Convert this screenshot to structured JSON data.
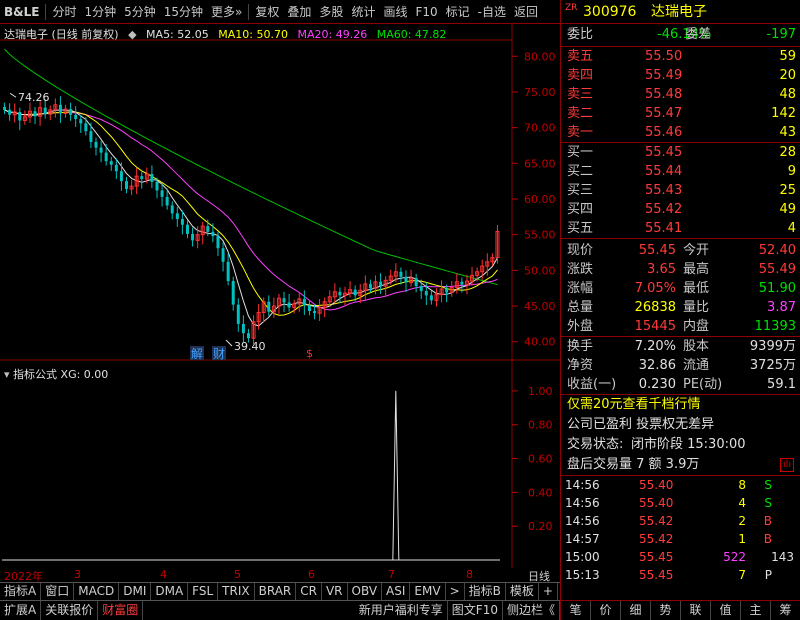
{
  "toolbar": {
    "logo": "B&LE",
    "items": [
      "分时",
      "1分钟",
      "5分钟",
      "15分钟",
      "更多»",
      "复权",
      "叠加",
      "多股",
      "统计",
      "画线",
      "F10",
      "标记",
      "-自选",
      "返回"
    ]
  },
  "main_info": {
    "name": "达瑞电子 (日线 前复权)",
    "ma5": "MA5: 52.05",
    "ma10": "MA10: 50.70",
    "ma20": "MA20: 49.26",
    "ma60": "MA60: 47.82"
  },
  "price_axis": [
    "80.00",
    "75.00",
    "70.00",
    "65.00",
    "60.00",
    "55.00",
    "50.00",
    "45.00",
    "40.00"
  ],
  "sub_axis": [
    "1.00",
    "0.80",
    "0.60",
    "0.40",
    "0.20"
  ],
  "annotations": {
    "high": "74.26",
    "low": "39.40",
    "tag_jie": "解",
    "tag_cai": "财",
    "tag_s": "$"
  },
  "sub_info": {
    "title": "指标公式 XG: 0.00"
  },
  "date_row": {
    "year": "2022年",
    "m3": "3",
    "m4": "4",
    "m5": "5",
    "m6": "6",
    "m7": "7",
    "m8": "8",
    "period": "日线"
  },
  "tabs1": [
    "指标A",
    "窗口",
    "MACD",
    "DMI",
    "DMA",
    "FSL",
    "TRIX",
    "BRAR",
    "CR",
    "VR",
    "OBV",
    "ASI",
    "EMV",
    ">",
    "指标B",
    "模板",
    "+",
    "-"
  ],
  "tabs2": [
    "扩展A",
    "关联报价",
    "财富圈",
    "新用户福利专享",
    "图文F10",
    "侧边栏《"
  ],
  "stock": {
    "zr": "ZR",
    "code": "300976",
    "name": "达瑞电子"
  },
  "wei": {
    "webi_label": "委比",
    "webi": "-46.14%",
    "weicha_label": "委差",
    "weicha": "-197"
  },
  "asks": [
    {
      "label": "卖五",
      "price": "55.50",
      "vol": "59"
    },
    {
      "label": "卖四",
      "price": "55.49",
      "vol": "20"
    },
    {
      "label": "卖三",
      "price": "55.48",
      "vol": "48"
    },
    {
      "label": "卖二",
      "price": "55.47",
      "vol": "142"
    },
    {
      "label": "卖一",
      "price": "55.46",
      "vol": "43"
    }
  ],
  "bids": [
    {
      "label": "买一",
      "price": "55.45",
      "vol": "28"
    },
    {
      "label": "买二",
      "price": "55.44",
      "vol": "9"
    },
    {
      "label": "买三",
      "price": "55.43",
      "vol": "25"
    },
    {
      "label": "买四",
      "price": "55.42",
      "vol": "49"
    },
    {
      "label": "买五",
      "price": "55.41",
      "vol": "4"
    }
  ],
  "quote": [
    {
      "l1": "现价",
      "v1": "55.45",
      "l2": "今开",
      "v2": "52.40"
    },
    {
      "l1": "涨跌",
      "v1": "3.65",
      "l2": "最高",
      "v2": "55.49"
    },
    {
      "l1": "涨幅",
      "v1": "7.05%",
      "l2": "最低",
      "v2": "51.90"
    },
    {
      "l1": "总量",
      "v1": "26838",
      "l2": "量比",
      "v2": "3.87"
    },
    {
      "l1": "外盘",
      "v1": "15445",
      "l2": "内盘",
      "v2": "11393"
    }
  ],
  "fund": [
    {
      "l1": "换手",
      "v1": "7.20%",
      "l2": "股本",
      "v2": "9399万"
    },
    {
      "l1": "净资",
      "v1": "32.86",
      "l2": "流通",
      "v2": "3725万"
    },
    {
      "l1": "收益(一)",
      "v1": "0.230",
      "l2": "PE(动)",
      "v2": "59.1"
    }
  ],
  "promo": "仅需20元查看千档行情",
  "notice": "公司已盈利 投票权无差异",
  "status_label": "交易状态:",
  "status_value": "闭市阶段 15:30:00",
  "after_hours": "盘后交易量 7 额 3.9万",
  "ticks": [
    {
      "t": "14:56",
      "p": "55.40",
      "v": "8",
      "d": "S"
    },
    {
      "t": "14:56",
      "p": "55.40",
      "v": "4",
      "d": "S"
    },
    {
      "t": "14:56",
      "p": "55.42",
      "v": "2",
      "d": "B"
    },
    {
      "t": "14:57",
      "p": "55.42",
      "v": "1",
      "d": "B"
    },
    {
      "t": "15:00",
      "p": "55.45",
      "v": "522",
      "d": "143"
    },
    {
      "t": "15:13",
      "p": "55.45",
      "v": "7",
      "d": "P"
    }
  ],
  "right_footer": [
    "笔",
    "价",
    "细",
    "势",
    "联",
    "值",
    "主",
    "筹"
  ],
  "chart_data": {
    "type": "candlestick",
    "title": "达瑞电子 (日线 前复权)",
    "ylim": [
      38,
      82
    ],
    "x_months": [
      "2022年",
      "3",
      "4",
      "5",
      "6",
      "7",
      "8"
    ],
    "close": [
      72.5,
      71.8,
      72.2,
      71.0,
      71.5,
      72.3,
      71.6,
      72.8,
      71.9,
      72.5,
      73.2,
      72.0,
      72.6,
      71.8,
      71.2,
      70.6,
      69.5,
      68.0,
      67.2,
      66.5,
      65.3,
      64.8,
      63.9,
      62.5,
      61.4,
      61.8,
      63.2,
      62.8,
      63.5,
      62.4,
      61.2,
      60.3,
      59.1,
      58.0,
      57.2,
      56.4,
      55.1,
      54.2,
      55.0,
      56.2,
      55.4,
      54.8,
      53.1,
      51.2,
      48.5,
      45.2,
      42.5,
      41.2,
      40.5,
      42.8,
      44.1,
      45.6,
      44.2,
      45.0,
      46.1,
      45.5,
      44.8,
      45.3,
      46.0,
      45.1,
      44.3,
      44.0,
      44.8,
      45.6,
      46.3,
      47.0,
      46.5,
      46.8,
      47.3,
      46.5,
      47.2,
      48.1,
      47.5,
      48.4,
      47.8,
      48.6,
      49.2,
      49.8,
      49.1,
      48.3,
      48.9,
      47.8,
      47.1,
      46.5,
      45.8,
      46.6,
      47.4,
      46.9,
      47.6,
      48.4,
      48.0,
      48.5,
      49.3,
      49.8,
      50.6,
      51.2,
      51.8,
      55.45
    ],
    "ma20_end": 49.26,
    "ma60_end": 47.82,
    "sub_ylim": [
      0,
      1.1
    ],
    "signal_index": 77,
    "signal_value": 1.0
  }
}
